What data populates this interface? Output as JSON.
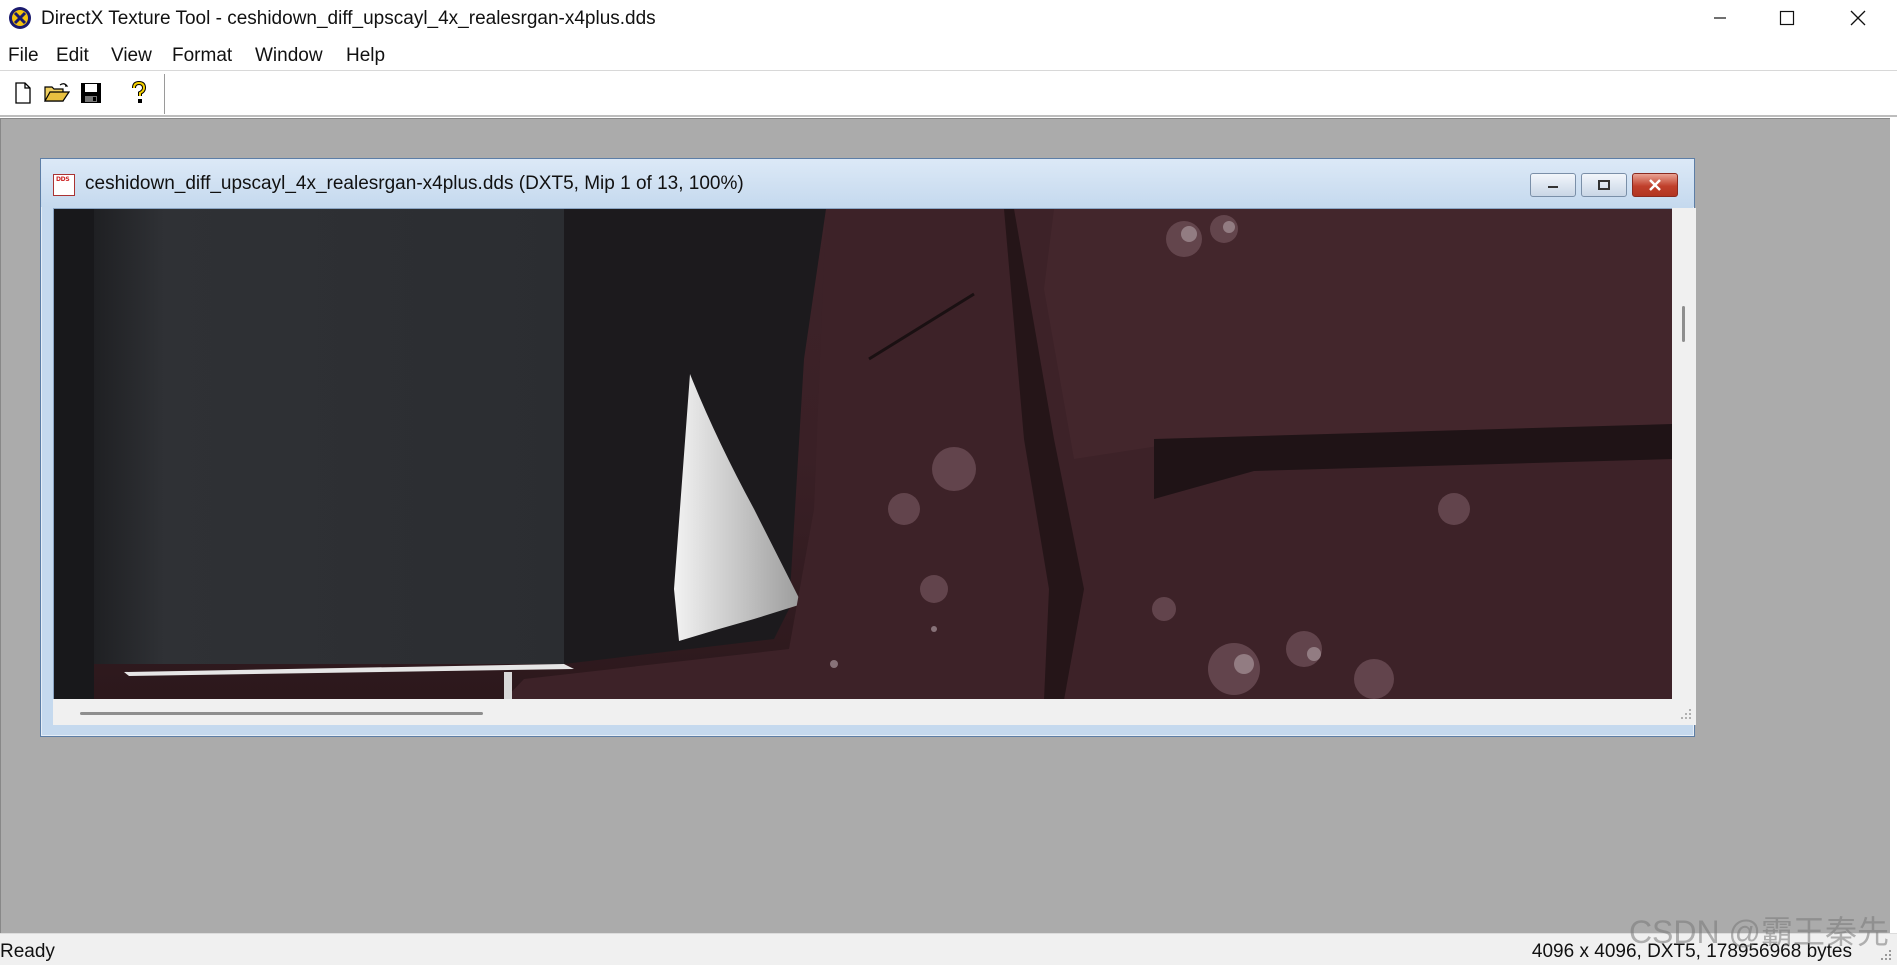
{
  "window": {
    "title": "DirectX Texture Tool - ceshidown_diff_upscayl_4x_realesrgan-x4plus.dds",
    "app_icon": "directx-icon",
    "controls": [
      "minimize-icon",
      "maximize-icon",
      "close-icon"
    ]
  },
  "menu": {
    "items": [
      "File",
      "Edit",
      "View",
      "Format",
      "Window",
      "Help"
    ]
  },
  "toolbar": {
    "buttons": [
      "new-document-icon",
      "open-folder-icon",
      "save-disk-icon",
      "help-question-icon"
    ]
  },
  "child_window": {
    "title": "ceshidown_diff_upscayl_4x_realesrgan-x4plus.dds (DXT5, Mip 1 of 13, 100%)",
    "icon": "dds-file-icon",
    "icon_text": "DDS",
    "controls": [
      "minimize-icon",
      "restore-icon",
      "close-icon"
    ]
  },
  "status": {
    "left": "Ready",
    "right": "4096 x 4096, DXT5, 178956968 bytes"
  },
  "watermark": "CSDN @霸王秦先",
  "colors": {
    "workspace": "#ababab",
    "child_frame": "#c5d9ee",
    "close_red": "#c0402c"
  }
}
